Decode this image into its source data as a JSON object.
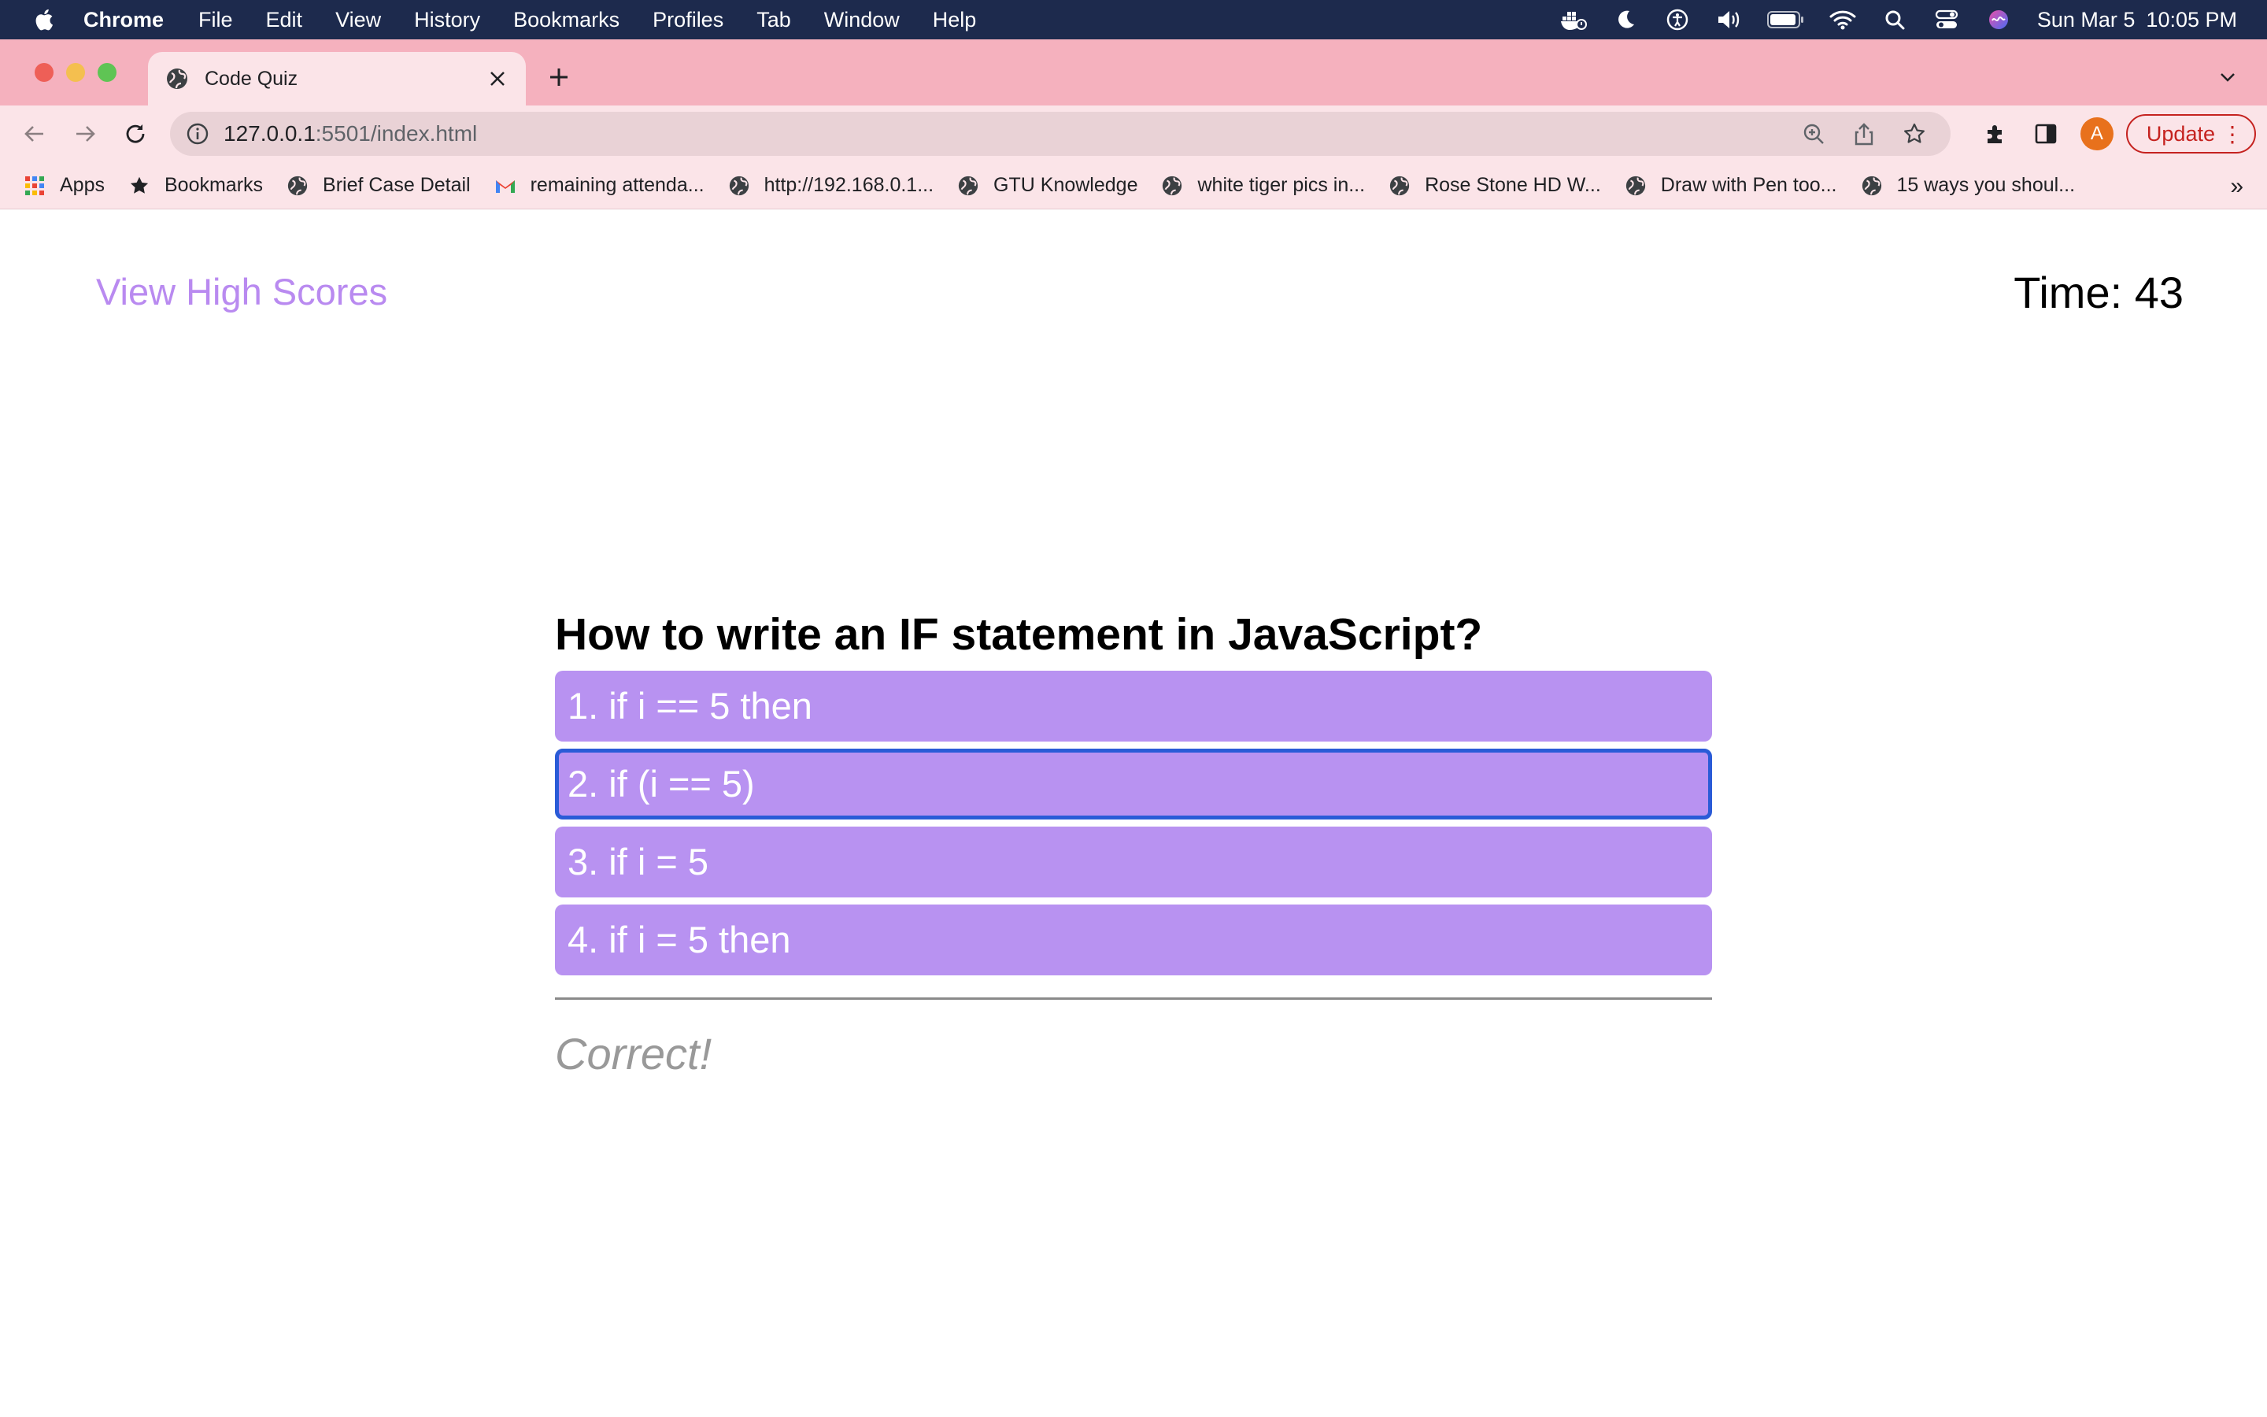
{
  "menubar": {
    "app": "Chrome",
    "items": [
      "File",
      "Edit",
      "View",
      "History",
      "Bookmarks",
      "Profiles",
      "Tab",
      "Window",
      "Help"
    ],
    "date": "Sun Mar 5",
    "time": "10:05 PM"
  },
  "browser": {
    "tab_title": "Code Quiz",
    "url_host": "127.0.0.1",
    "url_rest": ":5501/index.html",
    "update_label": "Update",
    "avatar_letter": "A",
    "bookmarks": [
      "Apps",
      "Bookmarks",
      "Brief Case Detail",
      "remaining attenda...",
      "http://192.168.0.1...",
      "GTU Knowledge",
      "white tiger pics in...",
      "Rose Stone HD W...",
      "Draw with Pen too...",
      "15 ways you shoul..."
    ]
  },
  "page": {
    "high_scores_link": "View High Scores",
    "timer": "Time: 43",
    "question": "How to write an IF statement in JavaScript?",
    "choices": [
      "1. if i == 5 then",
      "2. if (i == 5)",
      "3. if i = 5",
      "4. if i = 5 then"
    ],
    "feedback": "Correct!"
  },
  "colors": {
    "choice_bg": "#b892f1",
    "link": "#b98af0",
    "tab_strip": "#f5b1be",
    "focus_ring": "#2a5bd7"
  }
}
